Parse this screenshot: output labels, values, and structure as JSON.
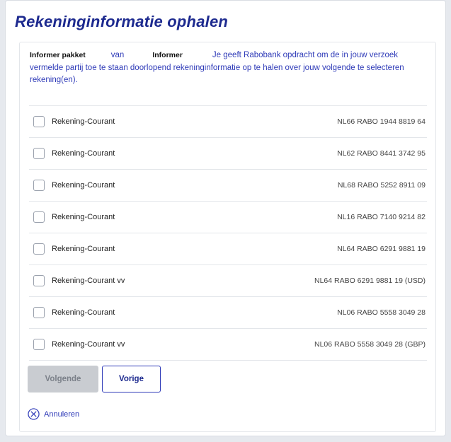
{
  "page": {
    "title": "Rekeninginformatie ophalen"
  },
  "intro": {
    "package_label": "Informer pakket",
    "van": "van",
    "provider": "Informer",
    "text_line1": "Je geeft Rabobank opdracht om de in jouw",
    "text_rest": "verzoek vermelde partij toe te staan doorlopend rekeninginformatie op te halen over jouw volgende te selecteren rekening(en)."
  },
  "accounts": [
    {
      "name": "Rekening-Courant",
      "iban": "NL66 RABO 1944 8819 64",
      "checked": false
    },
    {
      "name": "Rekening-Courant",
      "iban": "NL62 RABO 8441 3742 95",
      "checked": false
    },
    {
      "name": "Rekening-Courant",
      "iban": "NL68 RABO 5252 8911 09",
      "checked": false
    },
    {
      "name": "Rekening-Courant",
      "iban": "NL16 RABO 7140 9214 82",
      "checked": false
    },
    {
      "name": "Rekening-Courant",
      "iban": "NL64 RABO 6291 9881 19",
      "checked": false
    },
    {
      "name": "Rekening-Courant vv",
      "iban": "NL64 RABO 6291 9881 19 (USD)",
      "checked": false
    },
    {
      "name": "Rekening-Courant",
      "iban": "NL06 RABO 5558 3049 28",
      "checked": false
    },
    {
      "name": "Rekening-Courant vv",
      "iban": "NL06 RABO 5558 3049 28 (GBP)",
      "checked": false
    }
  ],
  "buttons": {
    "next_label": "Volgende",
    "prev_label": "Vorige",
    "cancel_label": "Annuleren",
    "cancel_icon": "close-circle-icon"
  },
  "colors": {
    "brand_blue": "#1d2a8f",
    "link_blue": "#2f3bb8",
    "disabled_gray": "#c9ccd1"
  }
}
